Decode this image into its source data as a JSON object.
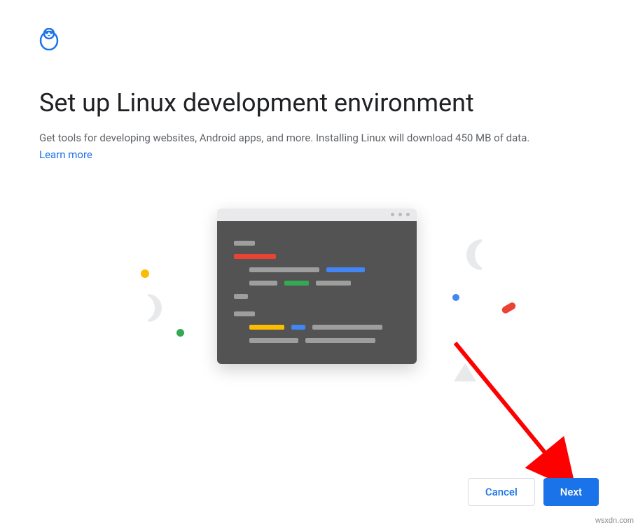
{
  "title": "Set up Linux development environment",
  "subtitle": "Get tools for developing websites, Android apps, and more. Installing Linux will download 450 MB of data.",
  "learn_more": "Learn more",
  "buttons": {
    "cancel": "Cancel",
    "next": "Next"
  },
  "colors": {
    "primary": "#1a73e8",
    "red": "#ea4335",
    "green": "#34a853",
    "yellow": "#fbbc04",
    "blue": "#4285f4"
  },
  "watermark": "wsxdn.com"
}
